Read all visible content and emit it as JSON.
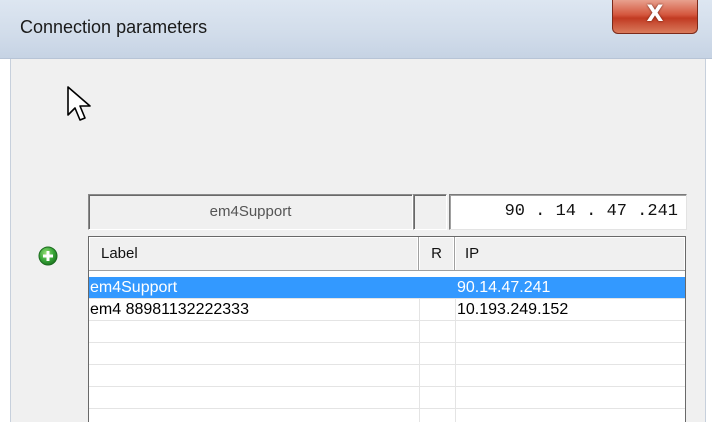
{
  "window": {
    "title": "Connection parameters",
    "close_label": "X"
  },
  "editor": {
    "label_value": "em4Support",
    "r_value": "",
    "ip_value": "90 . 14 . 47 .241"
  },
  "grid": {
    "columns": [
      "Label",
      "R",
      "IP"
    ],
    "rows": [
      {
        "label": "em4Support",
        "r": "",
        "ip": "90.14.47.241",
        "selected": true
      },
      {
        "label": "em4 88981132222333",
        "r": "",
        "ip": "10.193.249.152",
        "selected": false
      },
      {
        "label": "",
        "r": "",
        "ip": "",
        "selected": false
      },
      {
        "label": "",
        "r": "",
        "ip": "",
        "selected": false
      },
      {
        "label": "",
        "r": "",
        "ip": "",
        "selected": false
      },
      {
        "label": "",
        "r": "",
        "ip": "",
        "selected": false
      }
    ]
  },
  "icons": {
    "add": "plus-circle-icon",
    "cursor": "mouse-pointer-icon"
  },
  "colors": {
    "selection": "#3399ff",
    "add_icon": "#3aa83a",
    "close_button": "#c13a22"
  }
}
